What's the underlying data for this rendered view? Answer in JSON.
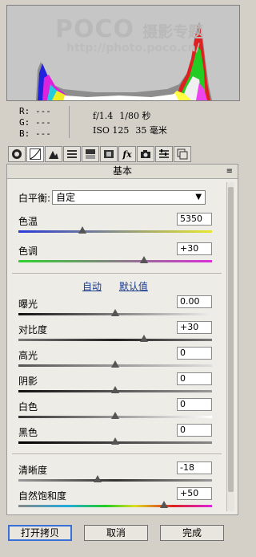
{
  "histogram": {
    "watermark_logo": "POCO",
    "watermark_cn": "摄影专题",
    "watermark_url": "http://photo.poco.cn/"
  },
  "info": {
    "r_label": "R:",
    "r_value": "---",
    "g_label": "G:",
    "g_value": "---",
    "b_label": "B:",
    "b_value": "---",
    "aperture": "f/1.4",
    "shutter": "1/80 秒",
    "iso": "ISO 125",
    "focal": "35 毫米"
  },
  "toolbar": {
    "icons": [
      "aperture-icon",
      "curve-icon",
      "sharpen-icon",
      "hsl-icon",
      "split-toning-icon",
      "lens-icon",
      "fx-icon",
      "camera-icon",
      "presets-icon",
      "snapshots-icon"
    ],
    "fx_label": "fx"
  },
  "panel": {
    "title": "基本",
    "menu_icon": "≡",
    "wb_label": "白平衡:",
    "wb_value": "自定",
    "auto_label": "自动",
    "default_label": "默认值"
  },
  "sliders": {
    "temp": {
      "label": "色温",
      "value": "5350",
      "position": 0.33
    },
    "tint": {
      "label": "色调",
      "value": "+30",
      "position": 0.65
    },
    "exposure": {
      "label": "曝光",
      "value": "0.00",
      "position": 0.5
    },
    "contrast": {
      "label": "对比度",
      "value": "+30",
      "position": 0.65
    },
    "highlights": {
      "label": "高光",
      "value": "0",
      "position": 0.5
    },
    "shadows": {
      "label": "阴影",
      "value": "0",
      "position": 0.5
    },
    "whites": {
      "label": "白色",
      "value": "0",
      "position": 0.5
    },
    "blacks": {
      "label": "黑色",
      "value": "0",
      "position": 0.5
    },
    "clarity": {
      "label": "清晰度",
      "value": "-18",
      "position": 0.41
    },
    "vibrance": {
      "label": "自然饱和度",
      "value": "+50",
      "position": 0.75
    }
  },
  "footer": {
    "open_copy": "打开拷贝",
    "cancel": "取消",
    "done": "完成"
  }
}
